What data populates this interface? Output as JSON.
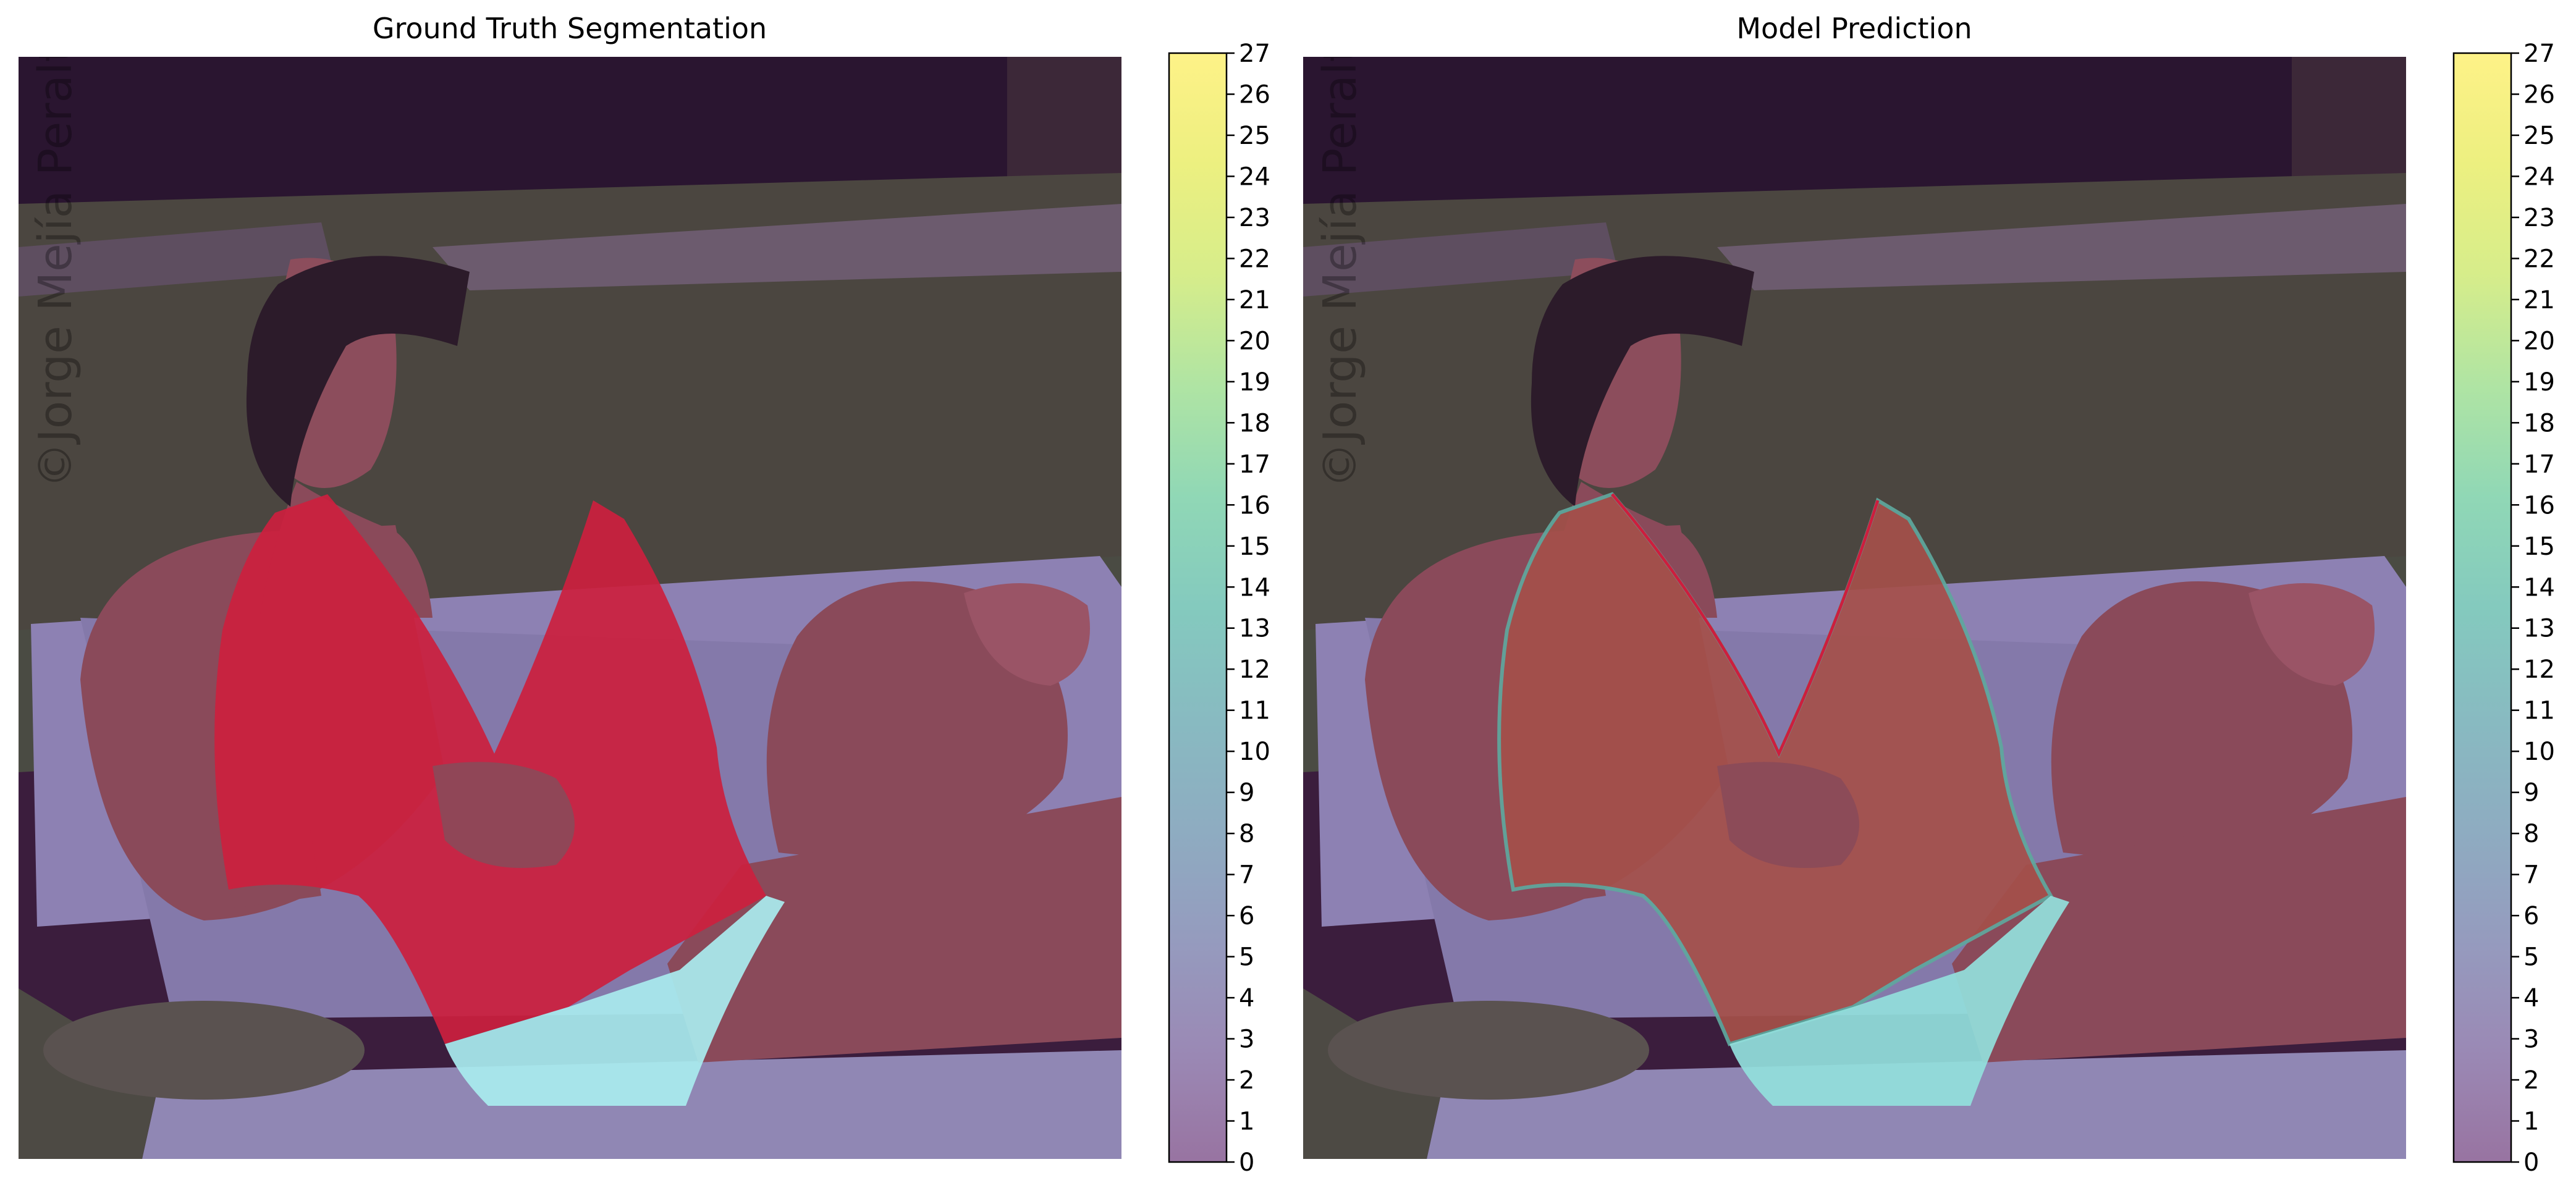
{
  "chart_data": [
    {
      "type": "heatmap",
      "title": "Ground Truth Segmentation",
      "content": "segmentation mask overlaid on photo",
      "colormap": "viridis",
      "overlay_alpha": 0.5,
      "watermark": "©Jorge Mejía Peralta",
      "colorbar": {
        "min": 0,
        "max": 27,
        "ticks": [
          0,
          1,
          2,
          3,
          4,
          5,
          6,
          7,
          8,
          9,
          10,
          11,
          12,
          13,
          14,
          15,
          16,
          17,
          18,
          19,
          20,
          21,
          22,
          23,
          24,
          25,
          26,
          27
        ]
      },
      "regions": [
        {
          "class_value": 0,
          "color": "#440154"
        },
        {
          "class_value": 4,
          "color": "#cc1f3e"
        },
        {
          "class_value": 15,
          "color": "#a9ecef"
        }
      ]
    },
    {
      "type": "heatmap",
      "title": "Model Prediction",
      "content": "predicted segmentation mask overlaid on photo",
      "colormap": "viridis",
      "overlay_alpha": 0.5,
      "watermark": "©Jorge Mejía Peralta",
      "colorbar": {
        "min": 0,
        "max": 27,
        "ticks": [
          0,
          1,
          2,
          3,
          4,
          5,
          6,
          7,
          8,
          9,
          10,
          11,
          12,
          13,
          14,
          15,
          16,
          17,
          18,
          19,
          20,
          21,
          22,
          23,
          24,
          25,
          26,
          27
        ]
      },
      "regions": [
        {
          "class_value": 0,
          "color": "#440154"
        },
        {
          "class_value": 4,
          "color": "#a5504a"
        },
        {
          "class_value": 15,
          "color": "#93dfdc"
        }
      ]
    }
  ],
  "colors": {
    "background_overlay": "#49234f",
    "grass": "#4d4a3f",
    "bench": "#8d81b3",
    "skin": "#8a4a5a",
    "hair": "#2c1b2a"
  }
}
